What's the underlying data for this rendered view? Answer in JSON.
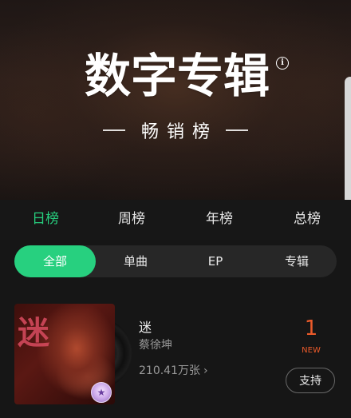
{
  "header": {
    "title": "数字专辑",
    "subtitle": "畅销榜",
    "info_icon": "info-icon"
  },
  "period_tabs": [
    {
      "label": "日榜",
      "active": true
    },
    {
      "label": "周榜",
      "active": false
    },
    {
      "label": "年榜",
      "active": false
    },
    {
      "label": "总榜",
      "active": false
    }
  ],
  "filters": [
    {
      "label": "全部",
      "active": true
    },
    {
      "label": "单曲",
      "active": false
    },
    {
      "label": "EP",
      "active": false
    },
    {
      "label": "专辑",
      "active": false
    }
  ],
  "albums": [
    {
      "cover_text": "迷",
      "title": "迷",
      "artist": "蔡徐坤",
      "sales": "210.41万张",
      "rank": "1",
      "rank_status": "NEW",
      "support_label": "支持"
    }
  ],
  "colors": {
    "accent": "#27d07f",
    "rank": "#ea5a2a",
    "background": "#161616",
    "pill_bar": "#272727"
  }
}
